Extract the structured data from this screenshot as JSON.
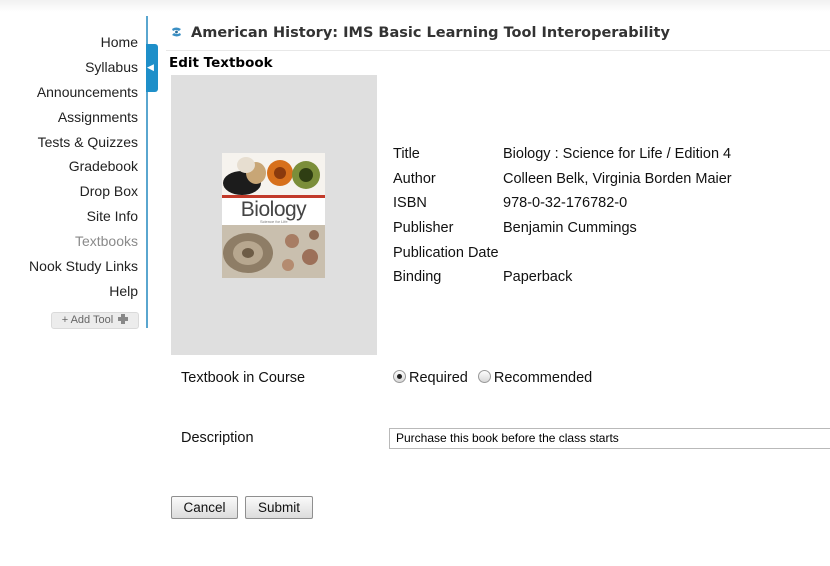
{
  "site": {
    "title": "American History: IMS Basic Learning Tool Interoperability"
  },
  "sidebar": {
    "items": [
      {
        "label": "Home"
      },
      {
        "label": "Syllabus"
      },
      {
        "label": "Announcements"
      },
      {
        "label": "Assignments"
      },
      {
        "label": "Tests & Quizzes"
      },
      {
        "label": "Gradebook"
      },
      {
        "label": "Drop Box"
      },
      {
        "label": "Site Info"
      },
      {
        "label": "Textbooks",
        "current": true
      },
      {
        "label": "Nook Study Links"
      },
      {
        "label": "Help"
      }
    ],
    "add_tool_label": "+ Add Tool"
  },
  "page": {
    "title": "Edit Textbook"
  },
  "book": {
    "cover_title": "Biology",
    "cover_subtitle": "Science for Life",
    "details": [
      {
        "label": "Title",
        "value": "Biology : Science for Life / Edition 4"
      },
      {
        "label": "Author",
        "value": "Colleen Belk, Virginia Borden Maier"
      },
      {
        "label": "ISBN",
        "value": "978-0-32-176782-0"
      },
      {
        "label": "Publisher",
        "value": "Benjamin Cummings"
      },
      {
        "label": "Publication Date",
        "value": ""
      },
      {
        "label": "Binding",
        "value": "Paperback"
      }
    ]
  },
  "form": {
    "course_label": "Textbook in Course",
    "options": [
      {
        "label": "Required",
        "selected": true
      },
      {
        "label": "Recommended",
        "selected": false
      }
    ],
    "description_label": "Description",
    "description_value": "Purchase this book before the class starts"
  },
  "buttons": {
    "cancel": "Cancel",
    "submit": "Submit"
  },
  "colors": {
    "accent": "#1e8fc9",
    "sidebar_border": "#5aa6cf",
    "current_item": "#8a8a8a"
  },
  "icons": {
    "site_icon": "sakai-swirl-icon",
    "collapse": "chevron-left-icon",
    "add": "plus-icon"
  }
}
